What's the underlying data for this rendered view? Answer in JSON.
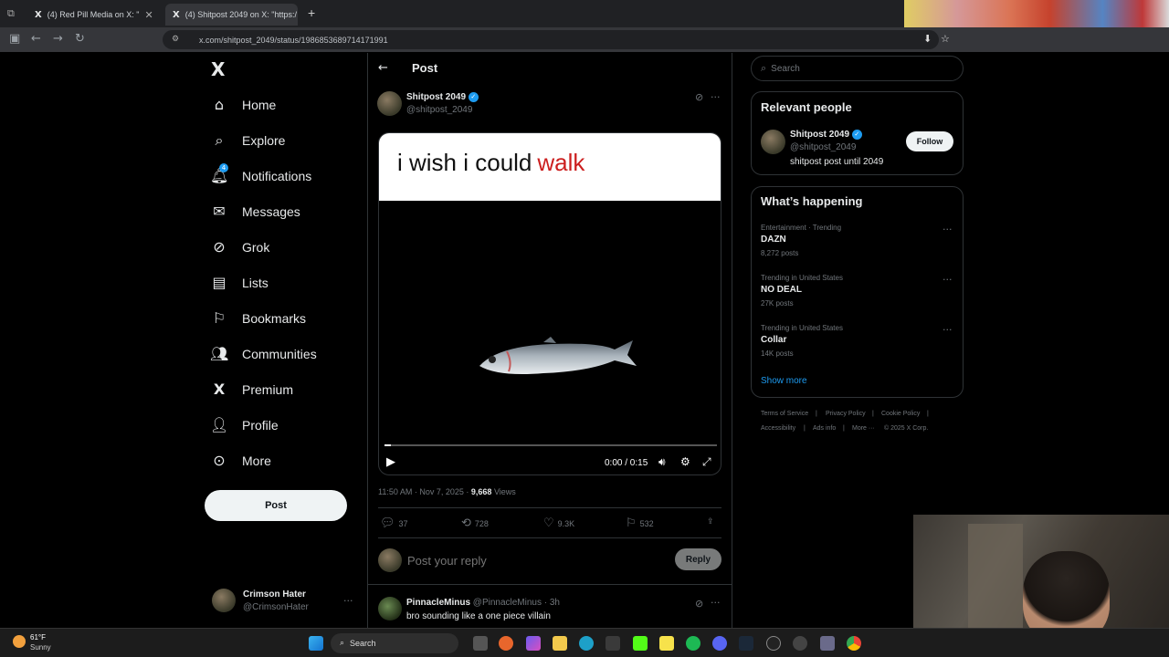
{
  "browser": {
    "tabs": [
      {
        "title": "(4) Red Pill Media on X: \"",
        "active": false
      },
      {
        "title": "(4) Shitpost 2049 on X: \"https:/",
        "active": true
      }
    ],
    "url": "x.com/shitpost_2049/status/1986853689714171991"
  },
  "nav": {
    "logo": "X",
    "items": [
      {
        "label": "Home",
        "icon": "home-icon"
      },
      {
        "label": "Explore",
        "icon": "search-icon"
      },
      {
        "label": "Notifications",
        "icon": "bell-icon",
        "badge": "4"
      },
      {
        "label": "Messages",
        "icon": "mail-icon"
      },
      {
        "label": "Grok",
        "icon": "grok-icon"
      },
      {
        "label": "Lists",
        "icon": "list-icon"
      },
      {
        "label": "Bookmarks",
        "icon": "bookmark-icon"
      },
      {
        "label": "Communities",
        "icon": "people-icon"
      },
      {
        "label": "Premium",
        "icon": "x-logo-icon"
      },
      {
        "label": "Profile",
        "icon": "person-icon"
      },
      {
        "label": "More",
        "icon": "more-circle-icon"
      }
    ],
    "post_label": "Post",
    "account": {
      "name": "Crimson Hater",
      "handle": "@CrimsonHater"
    }
  },
  "post": {
    "header_title": "Post",
    "author": {
      "name": "Shitpost 2049",
      "handle": "@shitpost_2049"
    },
    "caption_black": "i wish i could",
    "caption_red": "walk",
    "video_time": "0:00 / 0:15",
    "timestamp": "11:50 AM · Nov 7, 2025 ·",
    "views_count": "9,668",
    "views_label": "Views",
    "stats": {
      "replies": "37",
      "reposts": "728",
      "likes": "9.3K",
      "bookmarks": "532"
    },
    "reply_placeholder": "Post your reply",
    "reply_label": "Reply"
  },
  "reply": {
    "name": "PinnacleMinus",
    "handle": "@PinnacleMinus · 3h",
    "text": "bro sounding like a one piece villain"
  },
  "sidebar": {
    "search_placeholder": "Search",
    "relevant_title": "Relevant people",
    "person": {
      "name": "Shitpost 2049",
      "handle": "@shitpost_2049",
      "bio": "shitpost post until 2049",
      "follow_label": "Follow"
    },
    "happening_title": "What’s happening",
    "trends": [
      {
        "meta": "Entertainment · Trending",
        "name": "DAZN",
        "count": "8,272 posts"
      },
      {
        "meta": "Trending in United States",
        "name": "NO DEAL",
        "count": "27K posts"
      },
      {
        "meta": "Trending in United States",
        "name": "Collar",
        "count": "14K posts"
      }
    ],
    "show_more": "Show more",
    "footer": [
      "Terms of Service",
      "Privacy Policy",
      "Cookie Policy",
      "Accessibility",
      "Ads info",
      "More ···",
      "© 2025 X Corp."
    ]
  },
  "taskbar": {
    "weather_temp": "61°F",
    "weather_cond": "Sunny",
    "search_label": "Search"
  },
  "colors": {
    "accent": "#1d9bf0",
    "caption_red": "#cc1f1f",
    "background": "#000000"
  }
}
